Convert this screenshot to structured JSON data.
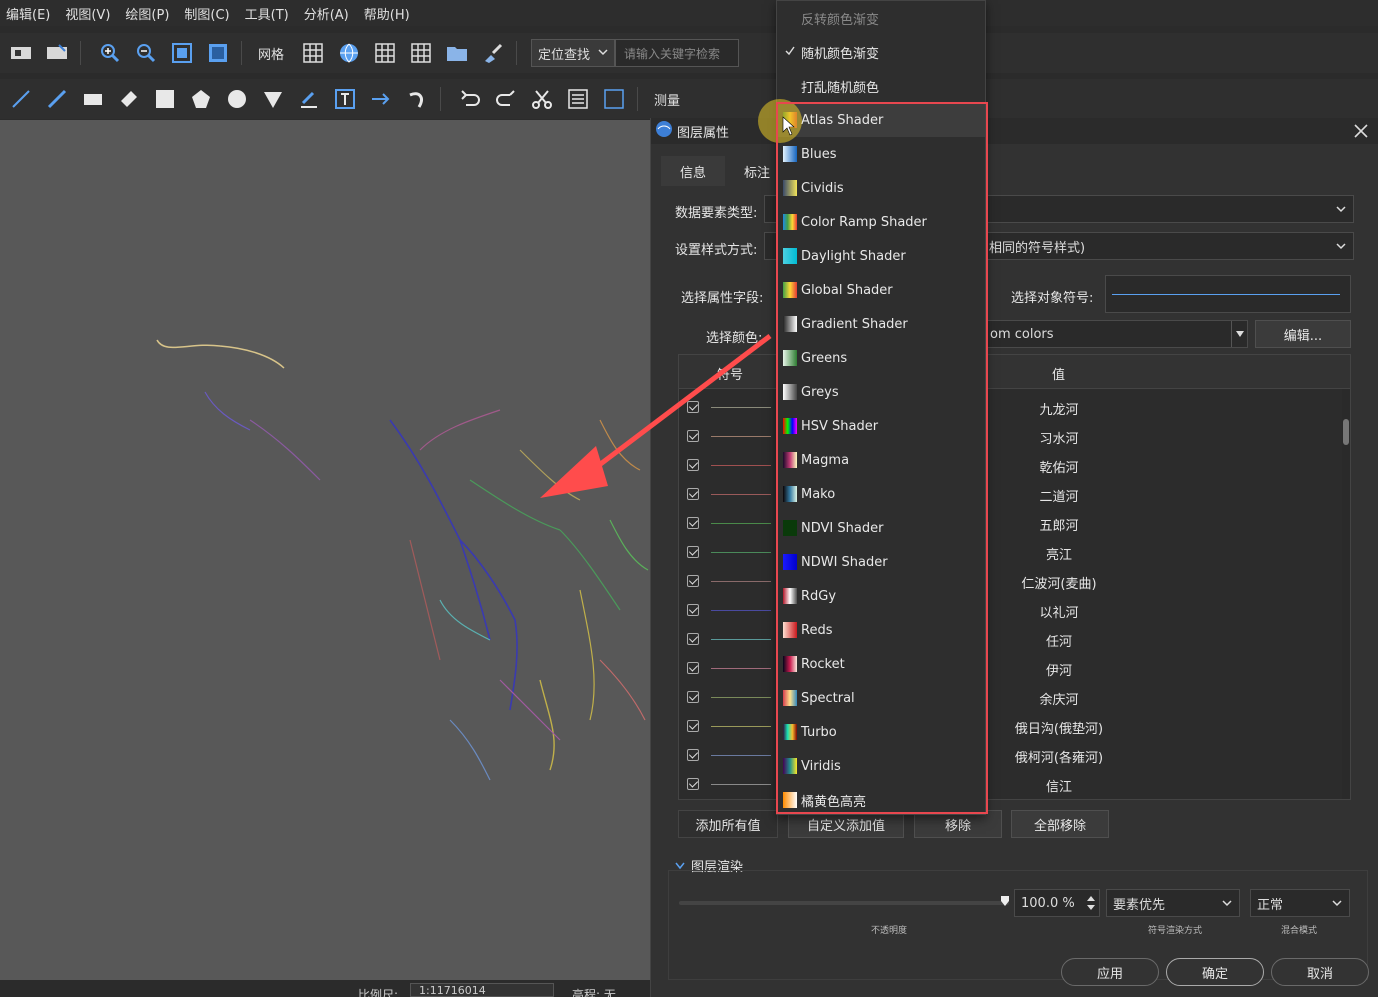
{
  "menubar": [
    "编辑(E)",
    "视图(V)",
    "绘图(P)",
    "制图(C)",
    "工具(T)",
    "分析(A)",
    "帮助(H)"
  ],
  "toolbar": {
    "grid_label": "网格",
    "locate_combo": "定位查找",
    "search_placeholder": "请输入关键字检索",
    "measure_label": "测量"
  },
  "dialog": {
    "title": "图层属性",
    "tabs": [
      "信息",
      "标注"
    ],
    "data_type_label": "数据要素类型:",
    "data_type_value": "",
    "style_mode_label": "设置样式方式:",
    "style_mode_value": "相同的符号样式)",
    "field_label": "选择属性字段:",
    "color_label": "选择颜色:",
    "color_value": "om colors",
    "edit_button": "编辑...",
    "object_symbol_label": "选择对象符号:",
    "table": {
      "col_symbol": "符号",
      "col_value": "值",
      "rows": [
        {
          "value": "九龙河",
          "color": "#8a8a7a"
        },
        {
          "value": "习水河",
          "color": "#9a7a6a"
        },
        {
          "value": "乾佑河",
          "color": "#a05050"
        },
        {
          "value": "二道河",
          "color": "#9a5a5a"
        },
        {
          "value": "五郎河",
          "color": "#4a8a4a"
        },
        {
          "value": "亮江",
          "color": "#4a8a5a"
        },
        {
          "value": "仁波河(麦曲)",
          "color": "#8a6a6a"
        },
        {
          "value": "以礼河",
          "color": "#4a4aa0"
        },
        {
          "value": "任河",
          "color": "#5a9a9a"
        },
        {
          "value": "伊河",
          "color": "#a06a7a"
        },
        {
          "value": "余庆河",
          "color": "#7a8a5a"
        },
        {
          "value": "俄日沟(俄垫河)",
          "color": "#9a9a5a"
        },
        {
          "value": "俄柯河(各雍河)",
          "color": "#6a7aa0"
        },
        {
          "value": "信江",
          "color": "#8a8a8a"
        }
      ]
    },
    "buttons": {
      "add_all": "添加所有值",
      "custom_add": "自定义添加值",
      "remove": "移除",
      "remove_all": "全部移除"
    },
    "render_section": "图层渲染",
    "opacity_value": "100.0 %",
    "opacity_caption": "不透明度",
    "symbol_mode_value": "要素优先",
    "symbol_mode_caption": "符号渲染方式",
    "blend_value": "正常",
    "blend_caption": "混合模式",
    "apply": "应用",
    "ok": "确定",
    "cancel": "取消"
  },
  "dropdown": {
    "top_items": [
      {
        "label": "反转颜色渐变",
        "checked": false,
        "disabled": true
      },
      {
        "label": "随机颜色渐变",
        "checked": true,
        "disabled": false
      },
      {
        "label": "打乱随机颜色",
        "checked": false,
        "disabled": false
      }
    ],
    "ramps": [
      {
        "label": "Atlas Shader",
        "colors": [
          "#2e7d32",
          "#fbc02d",
          "#d32f2f"
        ]
      },
      {
        "label": "Blues",
        "colors": [
          "#e3f2fd",
          "#1565c0"
        ]
      },
      {
        "label": "Cividis",
        "colors": [
          "#3a4a6a",
          "#f2e45a"
        ]
      },
      {
        "label": "Color Ramp Shader",
        "colors": [
          "#1e88e5",
          "#43a047",
          "#fdd835",
          "#e53935"
        ]
      },
      {
        "label": "Daylight Shader",
        "colors": [
          "#4dd0e1",
          "#00bcd4"
        ]
      },
      {
        "label": "Global Shader",
        "colors": [
          "#43a047",
          "#fdd835",
          "#e53935"
        ]
      },
      {
        "label": "Gradient Shader",
        "colors": [
          "#222222",
          "#ffffff"
        ]
      },
      {
        "label": "Greens",
        "colors": [
          "#e8f5e9",
          "#2e7d32"
        ]
      },
      {
        "label": "Greys",
        "colors": [
          "#ffffff",
          "#444444"
        ]
      },
      {
        "label": "HSV Shader",
        "colors": [
          "#ff0000",
          "#00ff00",
          "#0000ff",
          "#ff00ff"
        ]
      },
      {
        "label": "Magma",
        "colors": [
          "#1a0a2a",
          "#c23b75",
          "#fcfdbf"
        ]
      },
      {
        "label": "Mako",
        "colors": [
          "#0b0405",
          "#357ba3",
          "#def5e5"
        ]
      },
      {
        "label": "NDVI Shader",
        "colors": [
          "#0a3a0a",
          "#0a3a0a"
        ]
      },
      {
        "label": "NDWI Shader",
        "colors": [
          "#1a1aff",
          "#0000cc"
        ]
      },
      {
        "label": "RdGy",
        "colors": [
          "#b2182b",
          "#ffffff",
          "#4d4d4d"
        ]
      },
      {
        "label": "Reds",
        "colors": [
          "#fee0d2",
          "#cb181d"
        ]
      },
      {
        "label": "Rocket",
        "colors": [
          "#03051a",
          "#cb1b4f",
          "#faebdd"
        ]
      },
      {
        "label": "Spectral",
        "colors": [
          "#d53e4f",
          "#fee08b",
          "#3288bd"
        ]
      },
      {
        "label": "Turbo",
        "colors": [
          "#30123b",
          "#1ae4b6",
          "#fabd2f",
          "#7a0403"
        ]
      },
      {
        "label": "Viridis",
        "colors": [
          "#440154",
          "#21918c",
          "#fde725"
        ]
      },
      {
        "label": "橘黄色高亮",
        "colors": [
          "#ff8c00",
          "#ffffff"
        ]
      }
    ]
  },
  "status": {
    "scale_label": "比例尺:",
    "scale_value": "1:11716014",
    "elev_label": "高程: 无"
  },
  "colors": {
    "highlight_border": "#e8474f",
    "accent_blue": "#3d7fd6",
    "map_bg": "#585858"
  }
}
